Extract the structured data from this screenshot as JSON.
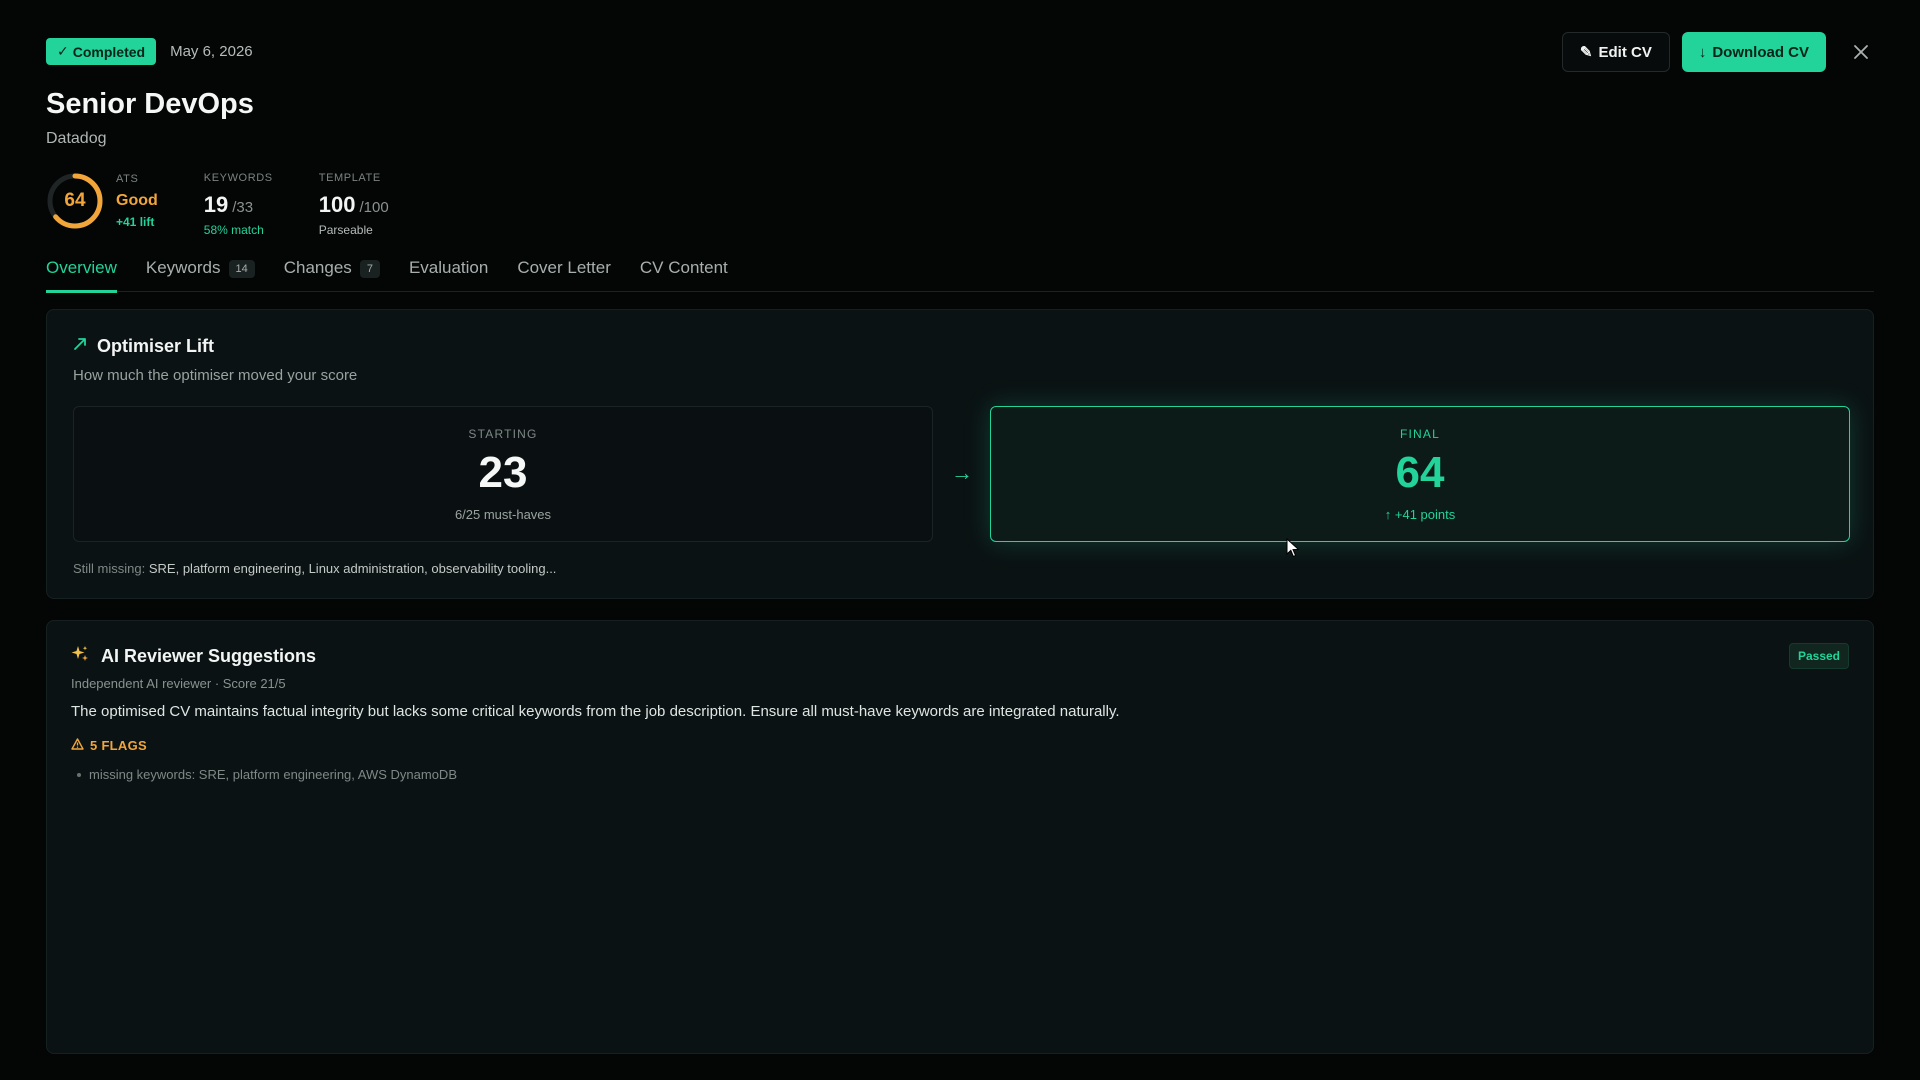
{
  "header": {
    "status_badge": "Completed",
    "date": "May 6, 2026",
    "title": "Senior DevOps",
    "company": "Datadog",
    "edit_label": "Edit CV",
    "download_label": "Download CV"
  },
  "stats": {
    "ats": {
      "label": "ATS",
      "score": "64",
      "score_value": 64,
      "rating": "Good",
      "lift": "+41 lift"
    },
    "keywords": {
      "label": "KEYWORDS",
      "value": "19",
      "total": "/33",
      "sub": "58% match"
    },
    "template": {
      "label": "TEMPLATE",
      "value": "100",
      "total": "/100",
      "sub": "Parseable"
    }
  },
  "tabs": [
    {
      "label": "Overview",
      "count": ""
    },
    {
      "label": "Keywords",
      "count": "14"
    },
    {
      "label": "Changes",
      "count": "7"
    },
    {
      "label": "Evaluation",
      "count": ""
    },
    {
      "label": "Cover Letter",
      "count": ""
    },
    {
      "label": "CV Content",
      "count": ""
    }
  ],
  "lift_card": {
    "title": "Optimiser Lift",
    "description": "How much the optimiser moved your score",
    "starting": {
      "label": "STARTING",
      "value": "23",
      "sub": "6/25 must-haves"
    },
    "final": {
      "label": "FINAL",
      "value": "64",
      "sub": "↑ +41 points"
    },
    "missing_label": "Still missing:",
    "missing_values": "SRE, platform engineering, Linux administration, observability tooling..."
  },
  "ai_card": {
    "title": "AI Reviewer Suggestions",
    "status": "Passed",
    "meta": "Independent AI reviewer · Score 21/5",
    "body": "The optimised CV maintains factual integrity but lacks some critical keywords from the job description. Ensure all must-have keywords are integrated naturally.",
    "flags_label": "5 FLAGS",
    "flags": [
      "missing keywords: SRE, platform engineering, AWS DynamoDB"
    ]
  },
  "colors": {
    "accent": "#22d39a",
    "warning": "#f2a63a",
    "background": "#040606",
    "card": "#0b1213"
  },
  "icons": {
    "status_badge": "check-icon",
    "edit": "pencil-icon",
    "download": "download-arrow-icon",
    "close": "close-icon",
    "lift": "trend-up-icon",
    "ai": "sparkles-icon",
    "flags": "warning-triangle-icon",
    "between_boxes": "arrow-right-icon"
  }
}
